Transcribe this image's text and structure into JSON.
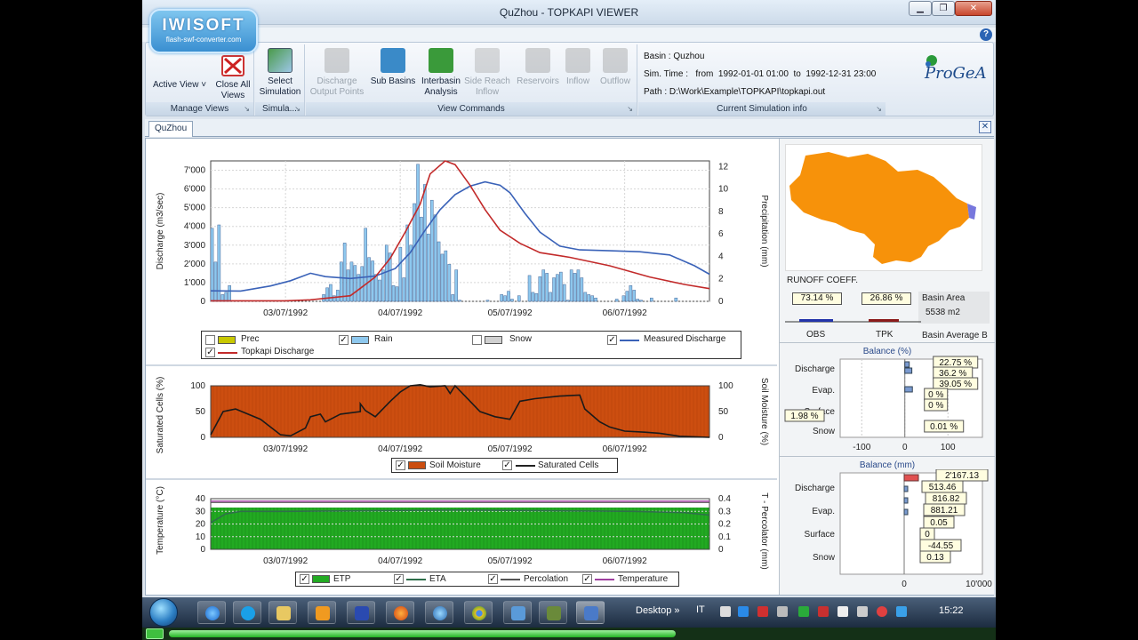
{
  "window": {
    "title": "QuZhou - TOPKAPI VIEWER",
    "minimize": "▁",
    "restore": "❐",
    "close": "✕"
  },
  "watermark": {
    "line1": "IWISOFT",
    "line2": "flash-swf-converter.com"
  },
  "help": "?",
  "ribbon": {
    "manage_views": {
      "label": "Manage Views",
      "active_view": "Active View ˅",
      "close_all_1": "Close All",
      "close_all_2": "Views"
    },
    "simulation": {
      "label": "Simula...",
      "select_1": "Select",
      "select_2": "Simulation"
    },
    "view_commands": {
      "label": "View Commands",
      "buttons": [
        {
          "l1": "Discharge",
          "l2": "Output Points",
          "enabled": false
        },
        {
          "l1": "Sub Basins",
          "l2": "",
          "enabled": true
        },
        {
          "l1": "Interbasin",
          "l2": "Analysis",
          "enabled": true
        },
        {
          "l1": "Side Reach",
          "l2": "Inflow",
          "enabled": false
        },
        {
          "l1": "Reservoirs",
          "l2": "",
          "enabled": false
        },
        {
          "l1": "Inflow",
          "l2": "",
          "enabled": false
        },
        {
          "l1": "Outflow",
          "l2": "",
          "enabled": false
        }
      ]
    },
    "sim_info": {
      "label": "Current Simulation info",
      "basin": "Basin : Quzhou",
      "time_label": "Sim. Time :",
      "from_label": "from",
      "from": "1992-01-01 01:00",
      "to_label": "to",
      "to": "1992-12-31 23:00",
      "path": "Path : D:\\Work\\Example\\TOPKAPI\\topkapi.out"
    },
    "brand": "ProGeA"
  },
  "tab": {
    "name": "QuZhou",
    "close": "✕"
  },
  "colors": {
    "rain": "#8ec8ee",
    "prec": "#c8c800",
    "snow": "#d0d0d0",
    "measured": "#3a62b8",
    "topkapi": "#c22a2a",
    "soil": "#cc4e10",
    "etp": "#22aa22",
    "eta": "#2f6f4a",
    "percolation": "#555555",
    "temperature": "#a040a0",
    "basin_map": "#f7920a",
    "obs_bar": "#2233aa",
    "tpk_bar": "#8b1a1a",
    "balance_bar": "#7a9ad0",
    "balance_red": "#e05050"
  },
  "chart_data": [
    {
      "type": "bar",
      "title": "",
      "xlabel": "",
      "ylabel": "Discharge (m3/sec)",
      "ylabel2": "Precipitation (mm)",
      "x_ticks": [
        "03/07/1992",
        "04/07/1992",
        "05/07/1992",
        "06/07/1992"
      ],
      "y_ticks": [
        "0",
        "1'000",
        "2'000",
        "3'000",
        "4'000",
        "5'000",
        "6'000",
        "7'000"
      ],
      "y2_ticks": [
        "0",
        "2",
        "4",
        "6",
        "8",
        "10",
        "12"
      ],
      "ylim": [
        0,
        7500
      ],
      "y2lim": [
        0,
        12.5
      ],
      "series": [
        {
          "name": "Rain",
          "axis": "right",
          "values": [
            6.5,
            3.5,
            6.8,
            0.6,
            0.8,
            1.4,
            0,
            0,
            0,
            0,
            0,
            0,
            0,
            0,
            0,
            0,
            0,
            0,
            0,
            0,
            0,
            0,
            0,
            0,
            0,
            0,
            0,
            0,
            0,
            0,
            0,
            0,
            0.6,
            1.2,
            1.5,
            0.5,
            1,
            3.5,
            5.2,
            2.8,
            3.5,
            3.2,
            2.4,
            3.1,
            6.5,
            3.9,
            3.6,
            2.4,
            1.9,
            2.8,
            5,
            4.3,
            1.4,
            1.3,
            4.8,
            2.1,
            6.8,
            5,
            8.7,
            12.2,
            7.5,
            10.4,
            6,
            9,
            7.7,
            5.3,
            4.2,
            4.5,
            3.3,
            0.6,
            2.8,
            0.1,
            0,
            0,
            0,
            0,
            0,
            0,
            0,
            0.1,
            0,
            0,
            0,
            0.6,
            0.5,
            0.9,
            0.2,
            0,
            0.5,
            0,
            0,
            2.3,
            0.8,
            0.7,
            2.2,
            2.8,
            2.5,
            0.8,
            2.1,
            2.4,
            2.6,
            1.5,
            0.1,
            2.8,
            2.5,
            2.8,
            2.1,
            0.8,
            0.6,
            0.5,
            0.3,
            0,
            0,
            0,
            0,
            0,
            0.2,
            0,
            0.5,
            0.9,
            1.4,
            1,
            0.2,
            0.1,
            0,
            0,
            0.3,
            0,
            0,
            0,
            0,
            0,
            0,
            0.3,
            0,
            0,
            0,
            0,
            0,
            0,
            0,
            0,
            0
          ]
        },
        {
          "name": "Measured Discharge",
          "axis": "left",
          "points": [
            [
              0,
              560
            ],
            [
              0.06,
              550
            ],
            [
              0.12,
              820
            ],
            [
              0.16,
              1100
            ],
            [
              0.2,
              1500
            ],
            [
              0.23,
              1320
            ],
            [
              0.28,
              1220
            ],
            [
              0.33,
              1350
            ],
            [
              0.37,
              1750
            ],
            [
              0.4,
              2600
            ],
            [
              0.43,
              3800
            ],
            [
              0.46,
              4900
            ],
            [
              0.49,
              5700
            ],
            [
              0.52,
              6150
            ],
            [
              0.55,
              6380
            ],
            [
              0.58,
              6200
            ],
            [
              0.6,
              5800
            ],
            [
              0.63,
              4700
            ],
            [
              0.66,
              3700
            ],
            [
              0.7,
              2950
            ],
            [
              0.74,
              2750
            ],
            [
              0.8,
              2700
            ],
            [
              0.86,
              2650
            ],
            [
              0.92,
              2480
            ],
            [
              0.97,
              1900
            ],
            [
              1,
              1450
            ]
          ]
        },
        {
          "name": "Topkapi Discharge",
          "axis": "left",
          "points": [
            [
              0,
              30
            ],
            [
              0.15,
              30
            ],
            [
              0.2,
              80
            ],
            [
              0.28,
              300
            ],
            [
              0.3,
              700
            ],
            [
              0.33,
              1300
            ],
            [
              0.36,
              2300
            ],
            [
              0.39,
              3700
            ],
            [
              0.42,
              5200
            ],
            [
              0.44,
              6800
            ],
            [
              0.47,
              7500
            ],
            [
              0.49,
              7300
            ],
            [
              0.52,
              6200
            ],
            [
              0.55,
              4900
            ],
            [
              0.58,
              3800
            ],
            [
              0.62,
              3100
            ],
            [
              0.66,
              2600
            ],
            [
              0.72,
              2350
            ],
            [
              0.8,
              1900
            ],
            [
              0.88,
              1300
            ],
            [
              0.95,
              900
            ],
            [
              1,
              680
            ]
          ]
        }
      ],
      "legend": [
        "Prec",
        "Rain",
        "Snow",
        "Measured Discharge",
        "Topkapi Discharge"
      ],
      "legend_checked": [
        false,
        true,
        false,
        true,
        true
      ]
    },
    {
      "type": "area",
      "title": "",
      "xlabel": "",
      "ylabel": "Saturated Cells (%)",
      "ylabel2": "Soil Moisture (%)",
      "x_ticks": [
        "03/07/1992",
        "04/07/1992",
        "05/07/1992",
        "06/07/1992"
      ],
      "y_ticks": [
        "0",
        "50",
        "100"
      ],
      "y2_ticks": [
        "0",
        "50",
        "100"
      ],
      "ylim": [
        0,
        100
      ],
      "series": [
        {
          "name": "Soil Moisture",
          "axis": "right",
          "value_constant": 100
        },
        {
          "name": "Saturated Cells",
          "axis": "left",
          "points": [
            [
              0,
              5
            ],
            [
              0.025,
              50
            ],
            [
              0.05,
              55
            ],
            [
              0.1,
              35
            ],
            [
              0.14,
              5
            ],
            [
              0.16,
              3
            ],
            [
              0.19,
              18
            ],
            [
              0.2,
              40
            ],
            [
              0.22,
              45
            ],
            [
              0.23,
              30
            ],
            [
              0.26,
              45
            ],
            [
              0.3,
              50
            ],
            [
              0.3,
              58
            ],
            [
              0.3,
              65
            ],
            [
              0.31,
              52
            ],
            [
              0.33,
              40
            ],
            [
              0.36,
              70
            ],
            [
              0.38,
              88
            ],
            [
              0.4,
              100
            ],
            [
              0.42,
              102
            ],
            [
              0.44,
              98
            ],
            [
              0.47,
              100
            ],
            [
              0.48,
              85
            ],
            [
              0.49,
              100
            ],
            [
              0.51,
              80
            ],
            [
              0.54,
              50
            ],
            [
              0.57,
              40
            ],
            [
              0.6,
              35
            ],
            [
              0.62,
              70
            ],
            [
              0.65,
              75
            ],
            [
              0.7,
              80
            ],
            [
              0.74,
              82
            ],
            [
              0.75,
              55
            ],
            [
              0.78,
              30
            ],
            [
              0.8,
              20
            ],
            [
              0.83,
              12
            ],
            [
              0.87,
              10
            ],
            [
              0.9,
              8
            ],
            [
              0.94,
              2
            ],
            [
              1,
              0
            ]
          ]
        }
      ],
      "legend": [
        "Soil Moisture",
        "Saturated Cells"
      ],
      "legend_checked": [
        true,
        true
      ]
    },
    {
      "type": "area",
      "title": "",
      "xlabel": "",
      "ylabel": "Temperature (°C)",
      "ylabel2": "T - Percolator (mm)",
      "x_ticks": [
        "03/07/1992",
        "04/07/1992",
        "05/07/1992",
        "06/07/1992"
      ],
      "y_ticks": [
        "0",
        "10",
        "20",
        "30",
        "40"
      ],
      "y2_ticks": [
        "0",
        "0.1",
        "0.2",
        "0.3",
        "0.4"
      ],
      "ylim": [
        0,
        40
      ],
      "series": [
        {
          "name": "ETP",
          "axis": "left",
          "value_constant": 33
        },
        {
          "name": "ETA",
          "axis": "left",
          "points": [
            [
              0,
              21
            ],
            [
              0.03,
              28
            ],
            [
              0.06,
              30
            ],
            [
              0.15,
              30
            ],
            [
              0.5,
              31
            ],
            [
              0.85,
              30
            ],
            [
              0.95,
              29
            ],
            [
              1,
              27
            ]
          ]
        },
        {
          "name": "Percolation",
          "axis": "right",
          "value_constant": 0.39
        },
        {
          "name": "Temperature",
          "axis": "left",
          "value_constant": 38
        }
      ],
      "legend": [
        "ETP",
        "ETA",
        "Percolation",
        "Temperature"
      ],
      "legend_checked": [
        true,
        true,
        true,
        true
      ]
    },
    {
      "type": "bar",
      "title": "Balance (%)",
      "ylabel": "",
      "categories": [
        "Discharge",
        "Evap.",
        "Surface",
        "Snow"
      ],
      "x_ticks": [
        "-100",
        "0",
        "100"
      ],
      "xlim": [
        -150,
        180
      ],
      "values_obs": [
        22.75,
        39.05,
        0,
        1.98
      ],
      "values_tpk": [
        36.2,
        null,
        0,
        0.01
      ],
      "labels": [
        "22.75 %",
        "36.2 %",
        "39.05 %",
        "0 %",
        "0 %",
        "1.98 %",
        "0.01 %"
      ]
    },
    {
      "type": "bar",
      "title": "Balance (mm)",
      "ylabel": "",
      "categories": [
        "Discharge",
        "Evap.",
        "Surface",
        "Snow"
      ],
      "x_ticks": [
        "0",
        "10'000"
      ],
      "labels": [
        "2'167.13",
        "513.46",
        "816.82",
        "881.21",
        "0.05",
        "0",
        "-44.55",
        "0.13"
      ]
    }
  ],
  "runoff": {
    "title": "RUNOFF COEFF.",
    "obs_value": "73.14 %",
    "tpk_value": "26.86 %",
    "obs_label": "OBS",
    "tpk_label": "TPK",
    "obs": 0.7314,
    "tpk": 0.2686
  },
  "basin_area": {
    "label": "Basin Area",
    "value": "5538 m2"
  },
  "basin_avg": "Basin Average B",
  "taskbar": {
    "desktop": "Desktop",
    "chevron": "»",
    "lang": "IT",
    "clock": "15:22",
    "progress": 0.62
  }
}
